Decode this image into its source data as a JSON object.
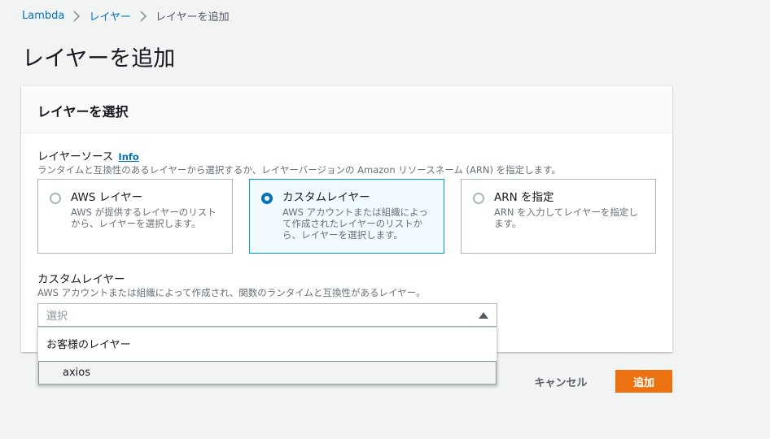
{
  "breadcrumb": {
    "items": [
      "Lambda",
      "レイヤー"
    ],
    "current": "レイヤーを追加"
  },
  "page": {
    "title": "レイヤーを追加"
  },
  "panel": {
    "title": "レイヤーを選択",
    "layer_source": {
      "label": "レイヤーソース",
      "info": "Info",
      "description": "ランタイムと互換性のあるレイヤーから選択するか、レイヤーバージョンの Amazon リソースネーム (ARN) を指定します。",
      "options": [
        {
          "title": "AWS レイヤー",
          "desc": "AWS が提供するレイヤーのリストから、レイヤーを選択します。",
          "selected": false
        },
        {
          "title": "カスタムレイヤー",
          "desc": "AWS アカウントまたは組織によって作成されたレイヤーのリストから、レイヤーを選択します。",
          "selected": true
        },
        {
          "title": "ARN を指定",
          "desc": "ARN を入力してレイヤーを指定します。",
          "selected": false
        }
      ]
    },
    "custom_layer": {
      "label": "カスタムレイヤー",
      "description": "AWS アカウントまたは組織によって作成され、関数のランタイムと互換性があるレイヤー。",
      "placeholder": "選択",
      "dropdown": {
        "group_label": "お客様のレイヤー",
        "options": [
          "axios"
        ]
      }
    }
  },
  "actions": {
    "cancel_label": "キャンセル",
    "add_label": "追加"
  },
  "colors": {
    "link": "#0073bb",
    "primary": "#ec7211",
    "selected_border": "#00a1c9"
  }
}
